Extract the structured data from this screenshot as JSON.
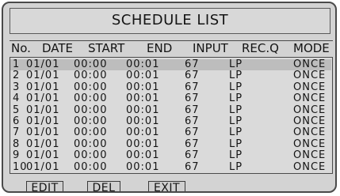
{
  "title": "SCHEDULE LIST",
  "columns": {
    "no": "No.",
    "date": "DATE",
    "start": "START",
    "end": "END",
    "input": "INPUT",
    "recq": "REC.Q",
    "mode": "MODE"
  },
  "rows": [
    {
      "no": "1",
      "date": "01/01",
      "start": "00:00",
      "end": "00:01",
      "input": "67",
      "recq": "LP",
      "mode": "ONCE"
    },
    {
      "no": "2",
      "date": "01/01",
      "start": "00:00",
      "end": "00:01",
      "input": "67",
      "recq": "LP",
      "mode": "ONCE"
    },
    {
      "no": "3",
      "date": "01/01",
      "start": "00:00",
      "end": "00:01",
      "input": "67",
      "recq": "LP",
      "mode": "ONCE"
    },
    {
      "no": "4",
      "date": "01/01",
      "start": "00:00",
      "end": "00:01",
      "input": "67",
      "recq": "LP",
      "mode": "ONCE"
    },
    {
      "no": "5",
      "date": "01/01",
      "start": "00:00",
      "end": "00:01",
      "input": "67",
      "recq": "LP",
      "mode": "ONCE"
    },
    {
      "no": "6",
      "date": "01/01",
      "start": "00:00",
      "end": "00:01",
      "input": "67",
      "recq": "LP",
      "mode": "ONCE"
    },
    {
      "no": "7",
      "date": "01/01",
      "start": "00:00",
      "end": "00:01",
      "input": "67",
      "recq": "LP",
      "mode": "ONCE"
    },
    {
      "no": "8",
      "date": "01/01",
      "start": "00:00",
      "end": "00:01",
      "input": "67",
      "recq": "LP",
      "mode": "ONCE"
    },
    {
      "no": "9",
      "date": "01/01",
      "start": "00:00",
      "end": "00:01",
      "input": "67",
      "recq": "LP",
      "mode": "ONCE"
    },
    {
      "no": "10",
      "date": "01/01",
      "start": "00:00",
      "end": "00:01",
      "input": "67",
      "recq": "LP",
      "mode": "ONCE"
    }
  ],
  "buttons": {
    "edit": "EDIT",
    "del": "DEL",
    "exit": "EXIT"
  }
}
